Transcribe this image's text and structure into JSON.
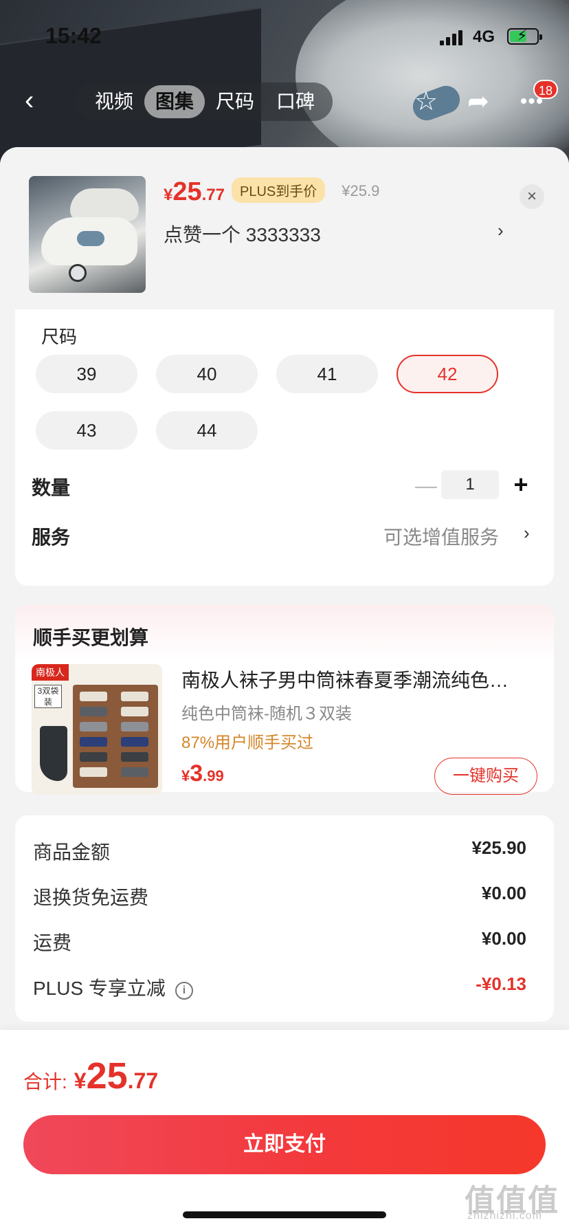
{
  "status": {
    "time": "15:42",
    "network": "4G"
  },
  "nav": {
    "tabs": [
      {
        "label": "视频",
        "active": false
      },
      {
        "label": "图集",
        "active": true
      },
      {
        "label": "尺码",
        "active": false
      },
      {
        "label": "口碑",
        "active": false
      }
    ],
    "cart_badge": "18"
  },
  "product": {
    "price_symbol": "¥",
    "price_int": "25",
    "price_dec": ".77",
    "plus_tag": "PLUS到手价",
    "original_price": "¥25.9",
    "variant": "点赞一个  3333333",
    "close_glyph": "×",
    "arrow": "›"
  },
  "size": {
    "title": "尺码",
    "options": [
      "39",
      "40",
      "41",
      "42",
      "43",
      "44"
    ],
    "selected": "42"
  },
  "quantity": {
    "label": "数量",
    "value": "1",
    "minus": "—",
    "plus": "+"
  },
  "service": {
    "label": "服务",
    "value": "可选增值服务",
    "arrow": "›"
  },
  "addon": {
    "title": "顺手买更划算",
    "name": "南极人袜子男中筒袜春夏季潮流纯色…",
    "spec": "纯色中筒袜-随机３双装",
    "rate": "87%用户顺手买过",
    "price_symbol": "¥",
    "price_int": "3",
    "price_dec": ".99",
    "buy_label": "一键购买",
    "img_logo": "南极人",
    "img_tag": "3双袋装"
  },
  "summary": [
    {
      "label": "商品金额",
      "value": "¥25.90",
      "red": false,
      "info": false
    },
    {
      "label": "退换货免运费",
      "value": "¥0.00",
      "red": false,
      "info": false
    },
    {
      "label": "运费",
      "value": "¥0.00",
      "red": false,
      "info": false
    },
    {
      "label": "PLUS 专享立减",
      "value": "-¥0.13",
      "red": true,
      "info": true
    }
  ],
  "footer": {
    "total_label": "合计:",
    "total_symbol": "¥",
    "total_int": "25",
    "total_dec": ".77",
    "pay_label": "立即支付",
    "watermark": "值值值",
    "watermark_sub": "zhizhizhi.com"
  },
  "colors": {
    "accent": "#e4322a",
    "plus_tag_bg": "#fbe2a8",
    "rate": "#d4862a"
  }
}
